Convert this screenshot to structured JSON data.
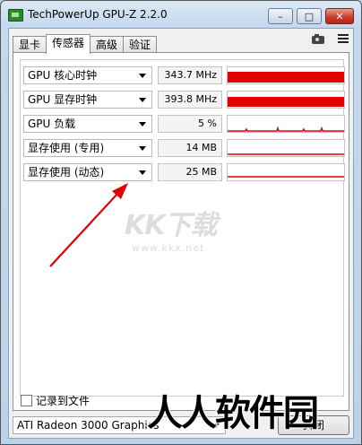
{
  "window": {
    "title": "TechPowerUp GPU-Z 2.2.0",
    "buttons": {
      "minimize": "–",
      "maximize": "□",
      "close": "✕"
    }
  },
  "tabs": [
    {
      "label": "显卡",
      "active": false
    },
    {
      "label": "传感器",
      "active": true
    },
    {
      "label": "高级",
      "active": false
    },
    {
      "label": "验证",
      "active": false
    }
  ],
  "toolbar_icons": [
    "camera-icon",
    "menu-icon"
  ],
  "sensors": [
    {
      "name": "GPU 核心时钟",
      "value": "343.7 MHz",
      "graph": "full"
    },
    {
      "name": "GPU 显存时钟",
      "value": "393.8 MHz",
      "graph": "full"
    },
    {
      "name": "GPU 负载",
      "value": "5 %",
      "graph": "spark"
    },
    {
      "name": "显存使用 (专用)",
      "value": "14 MB",
      "graph": "line"
    },
    {
      "name": "显存使用 (动态)",
      "value": "25 MB",
      "graph": "line"
    }
  ],
  "colors": {
    "graph": "#e00000",
    "annotation_arrow": "#e00000"
  },
  "log_to_file": {
    "label": "记录到文件",
    "checked": false
  },
  "device_select": {
    "value": "ATI Radeon 3000 Graphics"
  },
  "close_button": {
    "label": "关闭"
  },
  "watermarks": {
    "kk_main": "KK下载",
    "kk_url": "www.kkx.net",
    "rr": "人人软件园"
  }
}
